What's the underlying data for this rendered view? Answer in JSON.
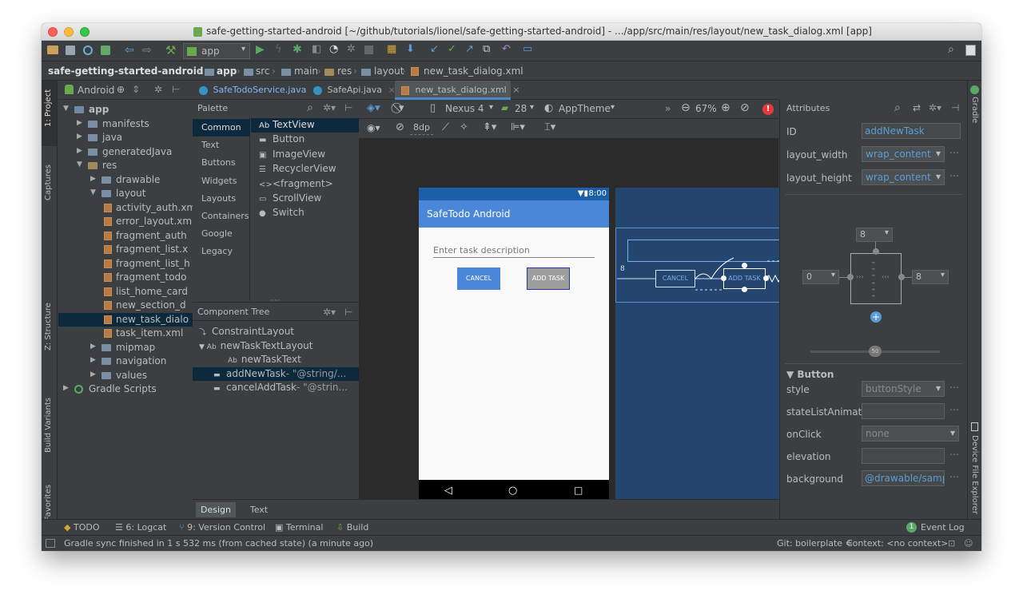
{
  "window": {
    "title": "safe-getting-started-android [~/github/tutorials/lionel/safe-getting-started-android] - .../app/src/main/res/layout/new_task_dialog.xml [app]"
  },
  "toolbar": {
    "run_config": "app"
  },
  "breadcrumbs": [
    "safe-getting-started-android",
    "app",
    "src",
    "main",
    "res",
    "layout",
    "new_task_dialog.xml"
  ],
  "left_strip": {
    "project": "1: Project",
    "captures": "Captures",
    "structure": "Z: Structure",
    "build_variants": "Build Variants",
    "favorites": "2: Favorites"
  },
  "right_strip": {
    "gradle": "Gradle",
    "device_explorer": "Device File Explorer"
  },
  "project": {
    "view_mode": "Android",
    "tree": [
      {
        "label": "app",
        "type": "module",
        "indent": 0,
        "open": true
      },
      {
        "label": "manifests",
        "type": "folder",
        "indent": 1
      },
      {
        "label": "java",
        "type": "folder",
        "indent": 1
      },
      {
        "label": "generatedJava",
        "type": "folder",
        "indent": 1
      },
      {
        "label": "res",
        "type": "folder",
        "indent": 1,
        "open": true
      },
      {
        "label": "drawable",
        "type": "folder",
        "indent": 2
      },
      {
        "label": "layout",
        "type": "folder",
        "indent": 2,
        "open": true
      },
      {
        "label": "activity_auth.xml",
        "type": "xml",
        "indent": 3
      },
      {
        "label": "error_layout.xml",
        "type": "xml",
        "indent": 3
      },
      {
        "label": "fragment_auth",
        "type": "xml",
        "indent": 3
      },
      {
        "label": "fragment_list.x",
        "type": "xml",
        "indent": 3
      },
      {
        "label": "fragment_list_h",
        "type": "xml",
        "indent": 3
      },
      {
        "label": "fragment_todo",
        "type": "xml",
        "indent": 3
      },
      {
        "label": "list_home_card",
        "type": "xml",
        "indent": 3
      },
      {
        "label": "new_section_d",
        "type": "xml",
        "indent": 3
      },
      {
        "label": "new_task_dialo",
        "type": "xml",
        "indent": 3,
        "selected": true
      },
      {
        "label": "task_item.xml",
        "type": "xml",
        "indent": 3
      },
      {
        "label": "mipmap",
        "type": "folder",
        "indent": 2
      },
      {
        "label": "navigation",
        "type": "folder",
        "indent": 2
      },
      {
        "label": "values",
        "type": "folder",
        "indent": 2
      },
      {
        "label": "Gradle Scripts",
        "type": "gradle",
        "indent": 0
      }
    ]
  },
  "editor_tabs": [
    {
      "label": "SafeTodoService.java"
    },
    {
      "label": "SafeApi.java"
    },
    {
      "label": "new_task_dialog.xml",
      "active": true
    }
  ],
  "palette": {
    "title": "Palette",
    "categories": [
      "Common",
      "Text",
      "Buttons",
      "Widgets",
      "Layouts",
      "Containers",
      "Google",
      "Legacy"
    ],
    "items": [
      {
        "label": "TextView",
        "glyph": "Ab"
      },
      {
        "label": "Button",
        "glyph": "▬"
      },
      {
        "label": "ImageView",
        "glyph": "▣"
      },
      {
        "label": "RecyclerView",
        "glyph": "☰"
      },
      {
        "label": "<fragment>",
        "glyph": "<>"
      },
      {
        "label": "ScrollView",
        "glyph": "▭"
      },
      {
        "label": "Switch",
        "glyph": "●"
      }
    ]
  },
  "component_tree": {
    "title": "Component Tree",
    "nodes": [
      {
        "label": "ConstraintLayout",
        "suffix": "",
        "indent": 0,
        "glyph": "⤵"
      },
      {
        "label": "newTaskTextLayout",
        "suffix": "",
        "indent": 1,
        "glyph": "Ab"
      },
      {
        "label": "newTaskText",
        "suffix": "",
        "indent": 2,
        "glyph": "Ab"
      },
      {
        "label": "addNewTask",
        "suffix": "- \"@string/...",
        "indent": 1,
        "glyph": "▬",
        "selected": true
      },
      {
        "label": "cancelAddTask",
        "suffix": "- \"@strin...",
        "indent": 1,
        "glyph": "▬"
      }
    ]
  },
  "design_toolbar": {
    "device": "Nexus 4",
    "api": "28",
    "theme": "AppTheme",
    "zoom": "67%",
    "margin": "8dp"
  },
  "phone": {
    "time": "8:00",
    "app_title": "SafeTodo Android",
    "hint": "Enter task description",
    "cancel": "CANCEL",
    "add_task": "ADD TASK"
  },
  "blueprint": {
    "margin_left": "8",
    "margin_right": "8",
    "cancel": "CANCEL",
    "add_task": "ADD TASK"
  },
  "attributes": {
    "title": "Attributes",
    "id_label": "ID",
    "id_value": "addNewTask",
    "layout_width_label": "layout_width",
    "layout_width_value": "wrap_content",
    "layout_height_label": "layout_height",
    "layout_height_value": "wrap_content",
    "constraint_top": "8",
    "constraint_left": "0",
    "constraint_right": "8",
    "bias": "50",
    "section": "Button",
    "rows": [
      {
        "label": "style",
        "value": "buttonStyle",
        "kind": "dropdown"
      },
      {
        "label": "stateListAnimat",
        "value": "",
        "kind": "field"
      },
      {
        "label": "onClick",
        "value": "none",
        "kind": "dropdown"
      },
      {
        "label": "elevation",
        "value": "",
        "kind": "field"
      },
      {
        "label": "background",
        "value": "@drawable/samp",
        "kind": "field-blue"
      }
    ]
  },
  "design_tabs": {
    "design": "Design",
    "text": "Text"
  },
  "bottom_tools": [
    {
      "label": "TODO"
    },
    {
      "label": "6: Logcat"
    },
    {
      "label": "9: Version Control"
    },
    {
      "label": "Terminal"
    },
    {
      "label": "Build"
    }
  ],
  "event_log": {
    "label": "Event Log",
    "count": "1"
  },
  "status": {
    "message": "Gradle sync finished in 1 s 532 ms (from cached state) (a minute ago)",
    "git": "Git: boilerplate ≑",
    "context": "Context: <no context>"
  },
  "colors": {
    "accent": "#4a88c7",
    "primary": "#4b87d8",
    "blueprint": "#24456d",
    "error": "#e8383d"
  }
}
